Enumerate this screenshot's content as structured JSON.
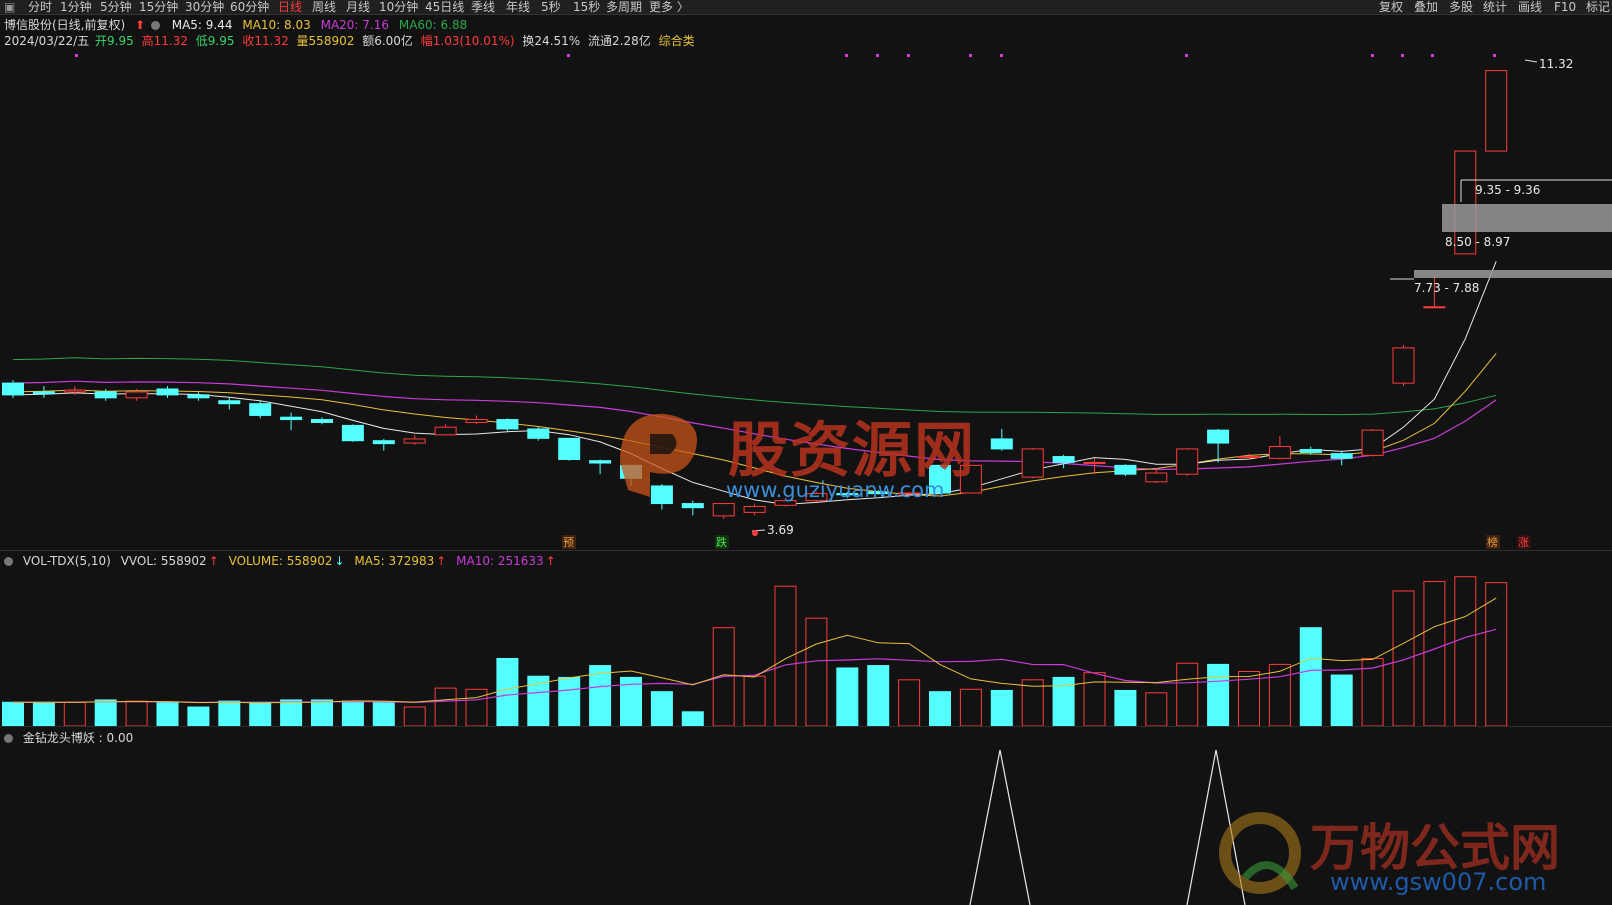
{
  "toolbar": {
    "left_tabs": [
      "分时",
      "1分钟",
      "5分钟",
      "15分钟",
      "30分钟",
      "60分钟",
      "日线",
      "周线",
      "月线",
      "10分钟",
      "45日线",
      "季线",
      "年线",
      "5秒",
      "15秒",
      "多周期",
      "更多 〉"
    ],
    "active_tab": "日线",
    "right_tabs": [
      "复权",
      "叠加",
      "多股",
      "统计",
      "画线",
      "F10",
      "标记"
    ]
  },
  "header": {
    "stock": "博信股份(日线,前复权)",
    "ma5": "MA5: 9.44",
    "ma10": "MA10: 8.03",
    "ma20": "MA20: 7.16",
    "ma60": "MA60: 6.88",
    "date": "2024/03/22/五",
    "open": "开9.95",
    "high": "高11.32",
    "low": "低9.95",
    "close": "收11.32",
    "vol": "量558902",
    "amount": "额6.00亿",
    "change": "幅1.03(10.01%)",
    "turnover": "换24.51%",
    "float_cap": "流通2.28亿",
    "category": "综合类"
  },
  "price_labels": {
    "high": "11.32",
    "low": "3.69",
    "zone1": "9.35 - 9.36",
    "zone2": "8.50 - 8.97",
    "zone3": "7.73 - 7.88",
    "marker_yu": "预",
    "marker_die": "跌",
    "marker_bang": "榜",
    "marker_zhang": "涨"
  },
  "volume_panel": {
    "name": "VOL-TDX(5,10)",
    "vvol": "VVOL: 558902",
    "volume": "VOLUME: 558902",
    "ma5": "MA5: 372983",
    "ma10": "MA10: 251633"
  },
  "indicator_panel": {
    "label": "金钻龙头博妖 : 0.00"
  },
  "watermarks": {
    "site1_name": "股资源网",
    "site1_url": "www.guziyuanw.com",
    "site2_name": "万物公式网",
    "site2_url": "www.gsw007.com"
  },
  "colors": {
    "up": "#ff3b3b",
    "down": "#54ffff",
    "ma5": "#e8e8e8",
    "ma10": "#e8c23a",
    "ma20": "#c83cd8",
    "ma60": "#2aa84a",
    "background": "#121212"
  },
  "chart_data": {
    "type": "candlestick",
    "candles": [
      {
        "o": 6.0,
        "c": 5.8,
        "h": 6.05,
        "l": 5.75
      },
      {
        "o": 5.85,
        "c": 5.82,
        "h": 5.95,
        "l": 5.75
      },
      {
        "o": 5.85,
        "c": 5.88,
        "h": 5.95,
        "l": 5.8
      },
      {
        "o": 5.85,
        "c": 5.75,
        "h": 5.9,
        "l": 5.7
      },
      {
        "o": 5.75,
        "c": 5.85,
        "h": 5.9,
        "l": 5.7
      },
      {
        "o": 5.9,
        "c": 5.8,
        "h": 5.95,
        "l": 5.75
      },
      {
        "o": 5.8,
        "c": 5.75,
        "h": 5.85,
        "l": 5.7
      },
      {
        "o": 5.7,
        "c": 5.65,
        "h": 5.75,
        "l": 5.55
      },
      {
        "o": 5.65,
        "c": 5.45,
        "h": 5.7,
        "l": 5.4
      },
      {
        "o": 5.42,
        "c": 5.38,
        "h": 5.5,
        "l": 5.2
      },
      {
        "o": 5.38,
        "c": 5.33,
        "h": 5.42,
        "l": 5.3
      },
      {
        "o": 5.28,
        "c": 5.02,
        "h": 5.3,
        "l": 5.0
      },
      {
        "o": 5.02,
        "c": 4.97,
        "h": 5.05,
        "l": 4.85
      },
      {
        "o": 4.98,
        "c": 5.05,
        "h": 5.12,
        "l": 4.95
      },
      {
        "o": 5.12,
        "c": 5.25,
        "h": 5.3,
        "l": 5.12
      },
      {
        "o": 5.33,
        "c": 5.38,
        "h": 5.45,
        "l": 5.3
      },
      {
        "o": 5.38,
        "c": 5.22,
        "h": 5.4,
        "l": 5.18
      },
      {
        "o": 5.22,
        "c": 5.06,
        "h": 5.25,
        "l": 5.02
      },
      {
        "o": 5.06,
        "c": 4.7,
        "h": 5.06,
        "l": 4.68
      },
      {
        "o": 4.68,
        "c": 4.64,
        "h": 4.7,
        "l": 4.45
      },
      {
        "o": 4.6,
        "c": 4.38,
        "h": 4.6,
        "l": 4.25
      },
      {
        "o": 4.25,
        "c": 3.95,
        "h": 4.28,
        "l": 3.85
      },
      {
        "o": 3.95,
        "c": 3.88,
        "h": 4.0,
        "l": 3.75
      },
      {
        "o": 3.74,
        "c": 3.95,
        "h": 3.95,
        "l": 3.69
      },
      {
        "o": 3.8,
        "c": 3.9,
        "h": 3.95,
        "l": 3.75
      },
      {
        "o": 3.92,
        "c": 4.0,
        "h": 4.05,
        "l": 3.9
      },
      {
        "o": 4.0,
        "c": 4.12,
        "h": 4.15,
        "l": 3.98
      },
      {
        "o": 4.12,
        "c": 4.1,
        "h": 4.15,
        "l": 4.05
      },
      {
        "o": 4.15,
        "c": 4.12,
        "h": 4.18,
        "l": 4.1
      },
      {
        "o": 4.13,
        "c": 4.13,
        "h": 4.14,
        "l": 4.12
      },
      {
        "o": 4.6,
        "c": 4.13,
        "h": 4.6,
        "l": 4.13
      },
      {
        "o": 4.13,
        "c": 4.6,
        "h": 4.6,
        "l": 4.13
      },
      {
        "o": 5.05,
        "c": 4.88,
        "h": 5.22,
        "l": 4.85
      },
      {
        "o": 4.4,
        "c": 4.88,
        "h": 4.9,
        "l": 4.38
      },
      {
        "o": 4.75,
        "c": 4.65,
        "h": 4.78,
        "l": 4.55
      },
      {
        "o": 4.65,
        "c": 4.65,
        "h": 4.72,
        "l": 4.45
      },
      {
        "o": 4.6,
        "c": 4.45,
        "h": 4.62,
        "l": 4.42
      },
      {
        "o": 4.32,
        "c": 4.47,
        "h": 4.55,
        "l": 4.3
      },
      {
        "o": 4.45,
        "c": 4.88,
        "h": 4.9,
        "l": 4.42
      },
      {
        "o": 5.2,
        "c": 4.98,
        "h": 5.22,
        "l": 4.65
      },
      {
        "o": 4.75,
        "c": 4.75,
        "h": 4.8,
        "l": 4.7
      },
      {
        "o": 4.72,
        "c": 4.92,
        "h": 5.1,
        "l": 4.7
      },
      {
        "o": 4.87,
        "c": 4.82,
        "h": 4.92,
        "l": 4.78
      },
      {
        "o": 4.8,
        "c": 4.72,
        "h": 4.85,
        "l": 4.6
      },
      {
        "o": 4.77,
        "c": 5.2,
        "h": 5.22,
        "l": 4.75
      },
      {
        "o": 6.0,
        "c": 6.6,
        "h": 6.65,
        "l": 5.95
      },
      {
        "o": 7.3,
        "c": 7.3,
        "h": 7.85,
        "l": 7.3
      },
      {
        "o": 8.2,
        "c": 9.95,
        "h": 9.95,
        "l": 8.2
      },
      {
        "o": 9.95,
        "c": 11.32,
        "h": 11.32,
        "l": 9.95
      }
    ],
    "volume": [
      27,
      20,
      18,
      22,
      20,
      18,
      21,
      20,
      18,
      22,
      20,
      20,
      20,
      22,
      21,
      20,
      16,
      21,
      20,
      22,
      22,
      21,
      20,
      16,
      32,
      31,
      57,
      42,
      41,
      51,
      41,
      29,
      12,
      83,
      42,
      118,
      91,
      49,
      51,
      39,
      29,
      31,
      30,
      39,
      41,
      45,
      30,
      28,
      53,
      52,
      46,
      52,
      83,
      43,
      57,
      114,
      122,
      126,
      121
    ]
  }
}
